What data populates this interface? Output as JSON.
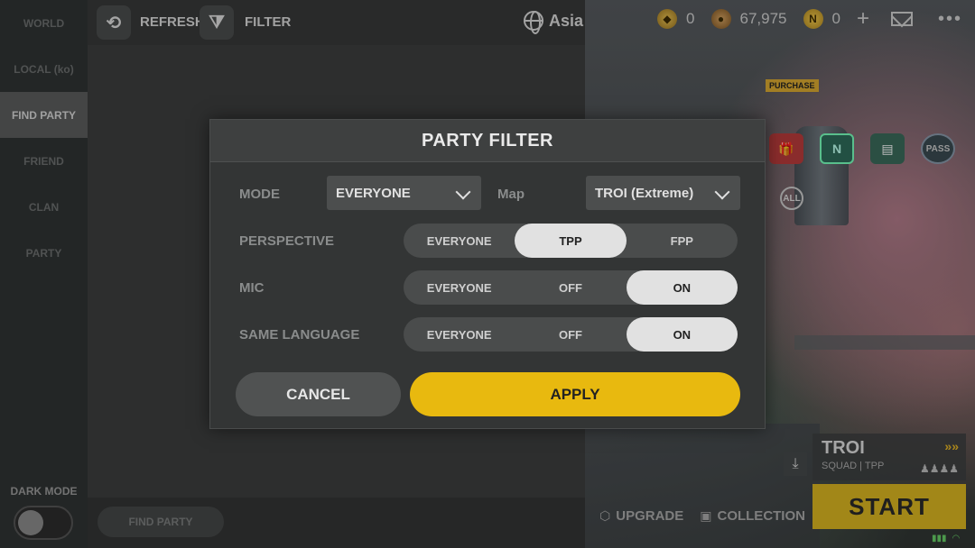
{
  "sidebar": {
    "tabs": [
      {
        "label": "WORLD"
      },
      {
        "label": "LOCAL (ko)"
      },
      {
        "label": "FIND PARTY"
      },
      {
        "label": "FRIEND"
      },
      {
        "label": "CLAN"
      },
      {
        "label": "PARTY"
      }
    ],
    "active_index": 2,
    "dark_mode_label": "DARK MODE"
  },
  "toolbar": {
    "refresh_label": "REFRESH",
    "filter_label": "FILTER",
    "region": "Asia"
  },
  "bottom": {
    "find_party_label": "FIND PARTY"
  },
  "hud": {
    "gold": "0",
    "bp": "67,975",
    "n_coin": "0",
    "plus": "+",
    "more": "•••"
  },
  "right": {
    "purchase_tag": "PURCHASE",
    "all_badge": "ALL",
    "pass_label": "PASS",
    "map_name": "TROI",
    "map_sub": "SQUAD | TPP",
    "start_label": "START",
    "upgrade_label": "UPGRADE",
    "collection_label": "COLLECTION"
  },
  "dialog": {
    "title": "PARTY FILTER",
    "mode_label": "MODE",
    "mode_value": "EVERYONE",
    "map_label": "Map",
    "map_value": "TROI (Extreme)",
    "perspective_label": "PERSPECTIVE",
    "perspective_options": [
      "EVERYONE",
      "TPP",
      "FPP"
    ],
    "perspective_selected": "TPP",
    "mic_label": "MIC",
    "mic_options": [
      "EVERYONE",
      "OFF",
      "ON"
    ],
    "mic_selected": "ON",
    "language_label": "SAME LANGUAGE",
    "language_options": [
      "EVERYONE",
      "OFF",
      "ON"
    ],
    "language_selected": "ON",
    "cancel_label": "CANCEL",
    "apply_label": "APPLY"
  },
  "colors": {
    "accent_yellow": "#e8b90f",
    "panel_bg": "#333535",
    "selected_seg": "#e1e1e1"
  }
}
